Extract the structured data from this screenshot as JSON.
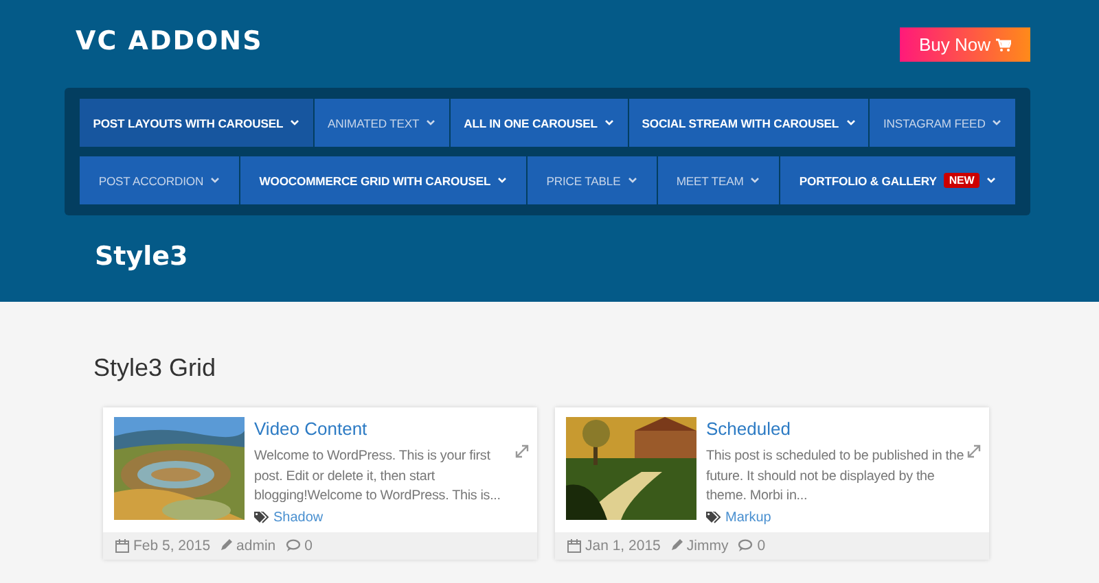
{
  "header": {
    "logo": "VC ADDONS",
    "buy_button": "Buy Now"
  },
  "menu_rows": [
    [
      {
        "label": "POST LAYOUTS WITH CAROUSEL",
        "selected": true,
        "kind": "strong"
      },
      {
        "label": "ANIMATED TEXT",
        "selected": false,
        "kind": "plain"
      },
      {
        "label": "ALL IN ONE CAROUSEL",
        "selected": false,
        "kind": "strong"
      },
      {
        "label": "SOCIAL STREAM WITH CAROUSEL",
        "selected": false,
        "kind": "strong"
      },
      {
        "label": "INSTAGRAM FEED",
        "selected": false,
        "kind": "plain"
      }
    ],
    [
      {
        "label": "POST ACCORDION",
        "selected": false,
        "kind": "plain"
      },
      {
        "label": "WOOCOMMERCE GRID WITH CAROUSEL",
        "selected": false,
        "kind": "strong"
      },
      {
        "label": "PRICE TABLE",
        "selected": false,
        "kind": "plain"
      },
      {
        "label": "MEET TEAM",
        "selected": false,
        "kind": "plain"
      },
      {
        "label": "PORTFOLIO & GALLERY",
        "badge": "NEW",
        "selected": false,
        "kind": "strong"
      }
    ]
  ],
  "page_title": "Style3",
  "section_title": "Style3 Grid",
  "posts": [
    {
      "title": "Video Content",
      "excerpt": "Welcome to WordPress. This is your first post. Edit or delete it, then start blogging!Welcome to WordPress. This is...",
      "tag": "Shadow",
      "date": "Feb 5, 2015",
      "author": "admin",
      "comments": "0",
      "kind": "picture"
    },
    {
      "title": "Scheduled",
      "excerpt": "This post is scheduled to be published in the future. It should not be displayed by the theme. Morbi in...",
      "tag": "Markup",
      "date": "Jan 1, 2015",
      "author": "Jimmy",
      "comments": "0",
      "kind": "picture"
    }
  ]
}
